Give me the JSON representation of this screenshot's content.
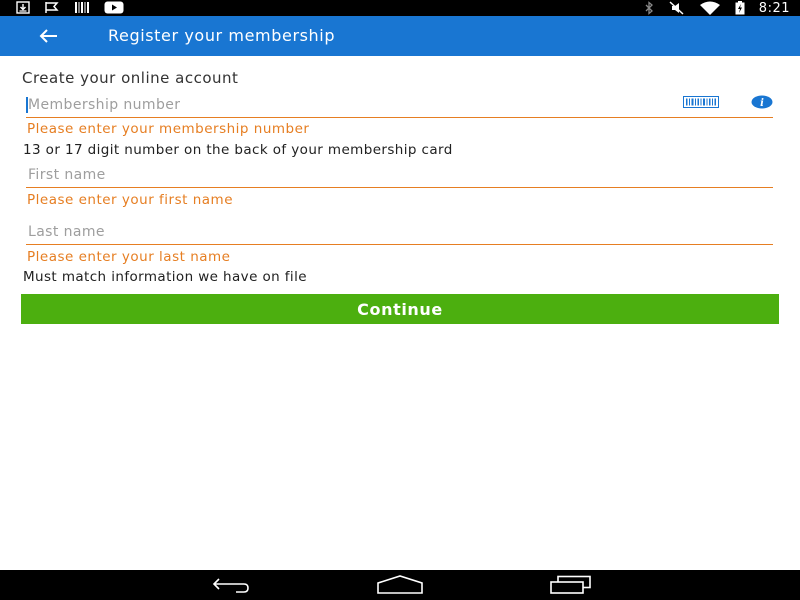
{
  "status_bar": {
    "time": "8:21",
    "left_icons": [
      "download-icon",
      "flag-icon",
      "barcode-notification-icon",
      "youtube-icon"
    ],
    "right_icons": [
      "bluetooth-icon",
      "mute-icon",
      "wifi-icon",
      "battery-charging-icon"
    ]
  },
  "app_bar": {
    "title": "Register your membership",
    "back_icon": "back-arrow-icon",
    "color": "#1976d2"
  },
  "form": {
    "section_title": "Create your online account",
    "membership": {
      "placeholder": "Membership number",
      "value": "",
      "error": "Please enter your membership number",
      "helper": "13 or 17 digit number on the back of your membership card",
      "icons": [
        "barcode-scan-icon",
        "info-icon"
      ]
    },
    "first_name": {
      "placeholder": "First name",
      "value": "",
      "error": "Please enter your first name"
    },
    "last_name": {
      "placeholder": "Last name",
      "value": "",
      "error": "Please enter your last name",
      "helper": "Must match information we have on file"
    },
    "continue_label": "Continue",
    "error_color": "#e67e22",
    "button_color": "#4caf0f"
  },
  "nav_bar": {
    "buttons": [
      "back-nav-icon",
      "home-nav-icon",
      "recents-nav-icon"
    ]
  }
}
